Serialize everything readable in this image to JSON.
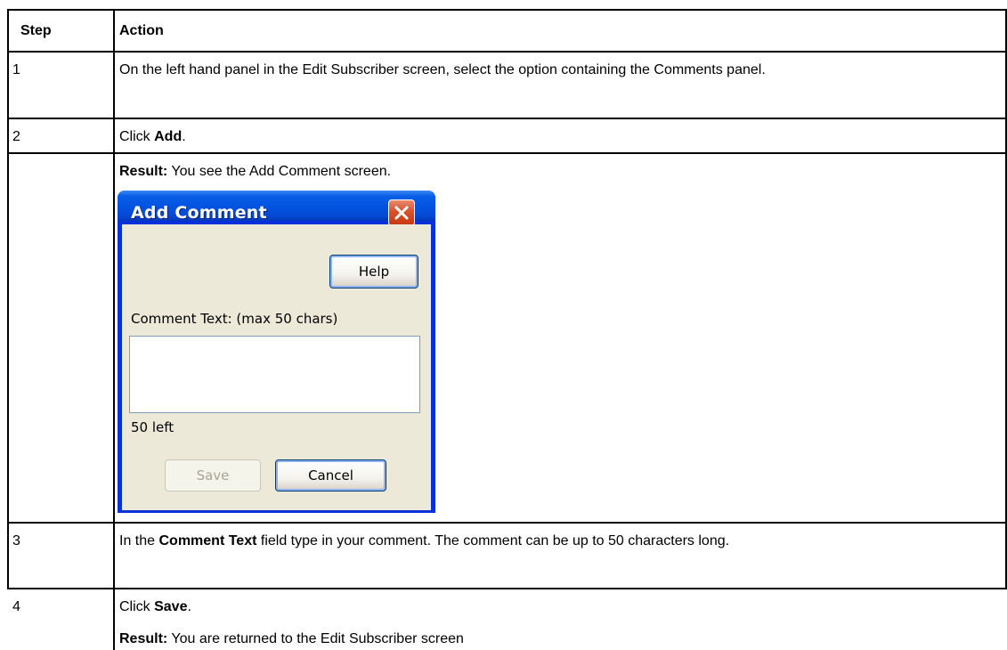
{
  "table": {
    "headers": {
      "step": "Step",
      "action": "Action"
    },
    "rows": [
      {
        "step": "1",
        "text": "On the left hand panel in the Edit Subscriber screen, select the option containing the Comments panel."
      },
      {
        "step": "2",
        "pre": "Click ",
        "bold": "Add",
        "post": "."
      },
      {
        "step": "",
        "bold": "Result:",
        "post": " You see the Add Comment screen."
      },
      {
        "step": "3",
        "pre": "In the ",
        "bold": "Comment Text",
        "post": " field type in your comment. The comment can be up to 50 characters long."
      },
      {
        "step": "4",
        "pre": "Click ",
        "bold": "Save",
        "post": ".",
        "result_bold": "Result:",
        "result_post": " You are returned to the Edit Subscriber screen"
      }
    ]
  },
  "dialog": {
    "title": "Add Comment",
    "help_label": "Help",
    "comment_label": "Comment Text:  (max 50 chars)",
    "comment_value": "",
    "remaining": "50 left",
    "save_label": "Save",
    "cancel_label": "Cancel",
    "close_icon": "close-icon",
    "colors": {
      "frame": "#0831d9",
      "body": "#ece9d8",
      "close": "#d9502c"
    }
  }
}
